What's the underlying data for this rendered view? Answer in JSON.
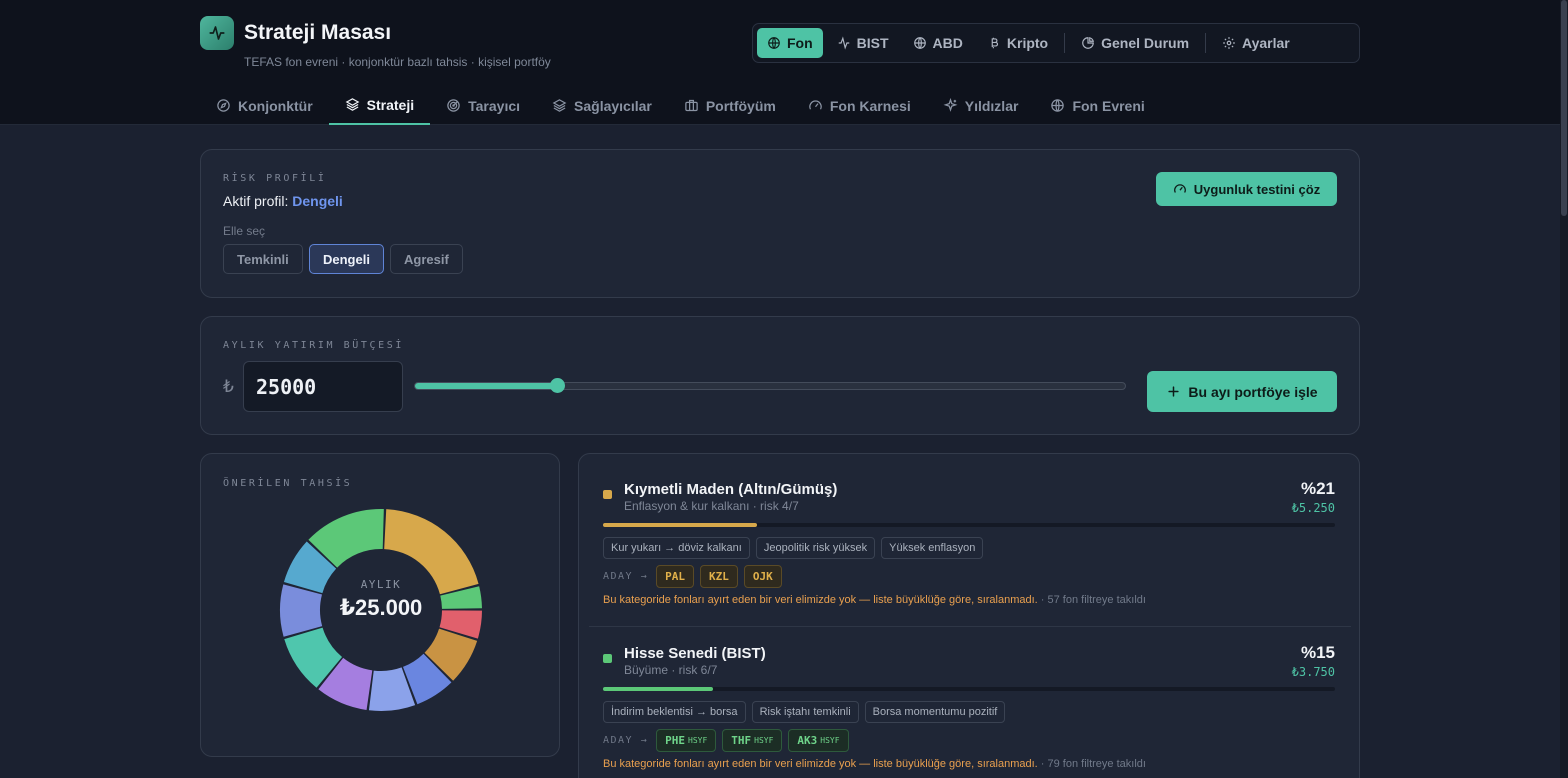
{
  "app": {
    "title": "Strateji Masası",
    "subtitle": "TEFAS fon evreni · konjonktür bazlı tahsis · kişisel portföy"
  },
  "markets": [
    {
      "label": "Fon",
      "icon": "globe-icon",
      "active": true
    },
    {
      "label": "BIST",
      "icon": "activity-icon",
      "active": false
    },
    {
      "label": "ABD",
      "icon": "globe-icon",
      "active": false
    },
    {
      "label": "Kripto",
      "icon": "bitcoin-icon",
      "active": false
    },
    {
      "label": "Genel Durum",
      "icon": "pie-chart-icon",
      "active": false
    },
    {
      "label": "Ayarlar",
      "icon": "gear-icon",
      "active": false
    }
  ],
  "tabs": [
    {
      "label": "Konjonktür",
      "icon": "compass-icon",
      "active": false
    },
    {
      "label": "Strateji",
      "icon": "layers-icon",
      "active": true
    },
    {
      "label": "Tarayıcı",
      "icon": "radar-icon",
      "active": false
    },
    {
      "label": "Sağlayıcılar",
      "icon": "layers-icon",
      "active": false
    },
    {
      "label": "Portföyüm",
      "icon": "briefcase-icon",
      "active": false
    },
    {
      "label": "Fon Karnesi",
      "icon": "gauge-icon",
      "active": false
    },
    {
      "label": "Yıldızlar",
      "icon": "sparkles-icon",
      "active": false
    },
    {
      "label": "Fon Evreni",
      "icon": "globe-icon",
      "active": false
    }
  ],
  "risk": {
    "section_label": "RİSK PROFİLİ",
    "active_prefix": "Aktif profil:",
    "active_value": "Dengeli",
    "manual_label": "Elle seç",
    "options": [
      "Temkinli",
      "Dengeli",
      "Agresif"
    ],
    "selected": "Dengeli",
    "test_button": "Uygunluk testini çöz"
  },
  "budget": {
    "section_label": "AYLIK YATIRIM BÜTÇESİ",
    "currency": "₺",
    "value": "25000",
    "slider_fraction": 0.2,
    "apply_button": "Bu ayı portföye işle"
  },
  "allocation": {
    "section_label": "ÖNERİLEN TAHSİS",
    "center_label": "AYLIK",
    "center_value": "₺25.000",
    "colors": {
      "gold": "#d7a84b",
      "green": "#5cc878",
      "red": "#e1606c",
      "bronze": "#c99343",
      "blue": "#6a86e0",
      "periwinkle": "#8ba2ea",
      "purple": "#a57ee0",
      "teal": "#4fc6ad",
      "indigo": "#7a8ddc",
      "sky": "#56a9cf"
    }
  },
  "categories": [
    {
      "name": "Kıymetli Maden (Altın/Gümüş)",
      "desc": "Enflasyon & kur kalkanı · risk 4/7",
      "pct": "%21",
      "amount": "₺5.250",
      "fill": 0.21,
      "color": "#d7a84b",
      "chips": [
        "Kur yukarı → döviz kalkanı",
        "Jeopolitik risk yüksek",
        "Yüksek enflasyon"
      ],
      "candidates_label": "ADAY →",
      "candidates": [
        {
          "code": "PAL",
          "tag": ""
        },
        {
          "code": "KZL",
          "tag": ""
        },
        {
          "code": "OJK",
          "tag": ""
        }
      ],
      "cand_color": "#e0b04a",
      "cand_bg": "#2f2a1e",
      "cand_border": "#5a4a26",
      "note_warn": "Bu kategoride fonları ayırt eden bir veri elimizde yok — liste büyüklüğe göre, sıralanmadı.",
      "note_muted": "· 57 fon filtreye takıldı"
    },
    {
      "name": "Hisse Senedi (BIST)",
      "desc": "Büyüme · risk 6/7",
      "pct": "%15",
      "amount": "₺3.750",
      "fill": 0.15,
      "color": "#5cc878",
      "chips": [
        "İndirim beklentisi → borsa",
        "Risk iştahı temkinli",
        "Borsa momentumu pozitif"
      ],
      "candidates_label": "ADAY →",
      "candidates": [
        {
          "code": "PHE",
          "tag": "HSYF"
        },
        {
          "code": "THF",
          "tag": "HSYF"
        },
        {
          "code": "AK3",
          "tag": "HSYF"
        }
      ],
      "cand_color": "#6fd48a",
      "cand_bg": "#1c2d25",
      "cand_border": "#2e5a3c",
      "note_warn": "Bu kategoride fonları ayırt eden bir veri elimizde yok — liste büyüklüğe göre, sıralanmadı.",
      "note_muted": "· 79 fon filtreye takıldı"
    }
  ]
}
